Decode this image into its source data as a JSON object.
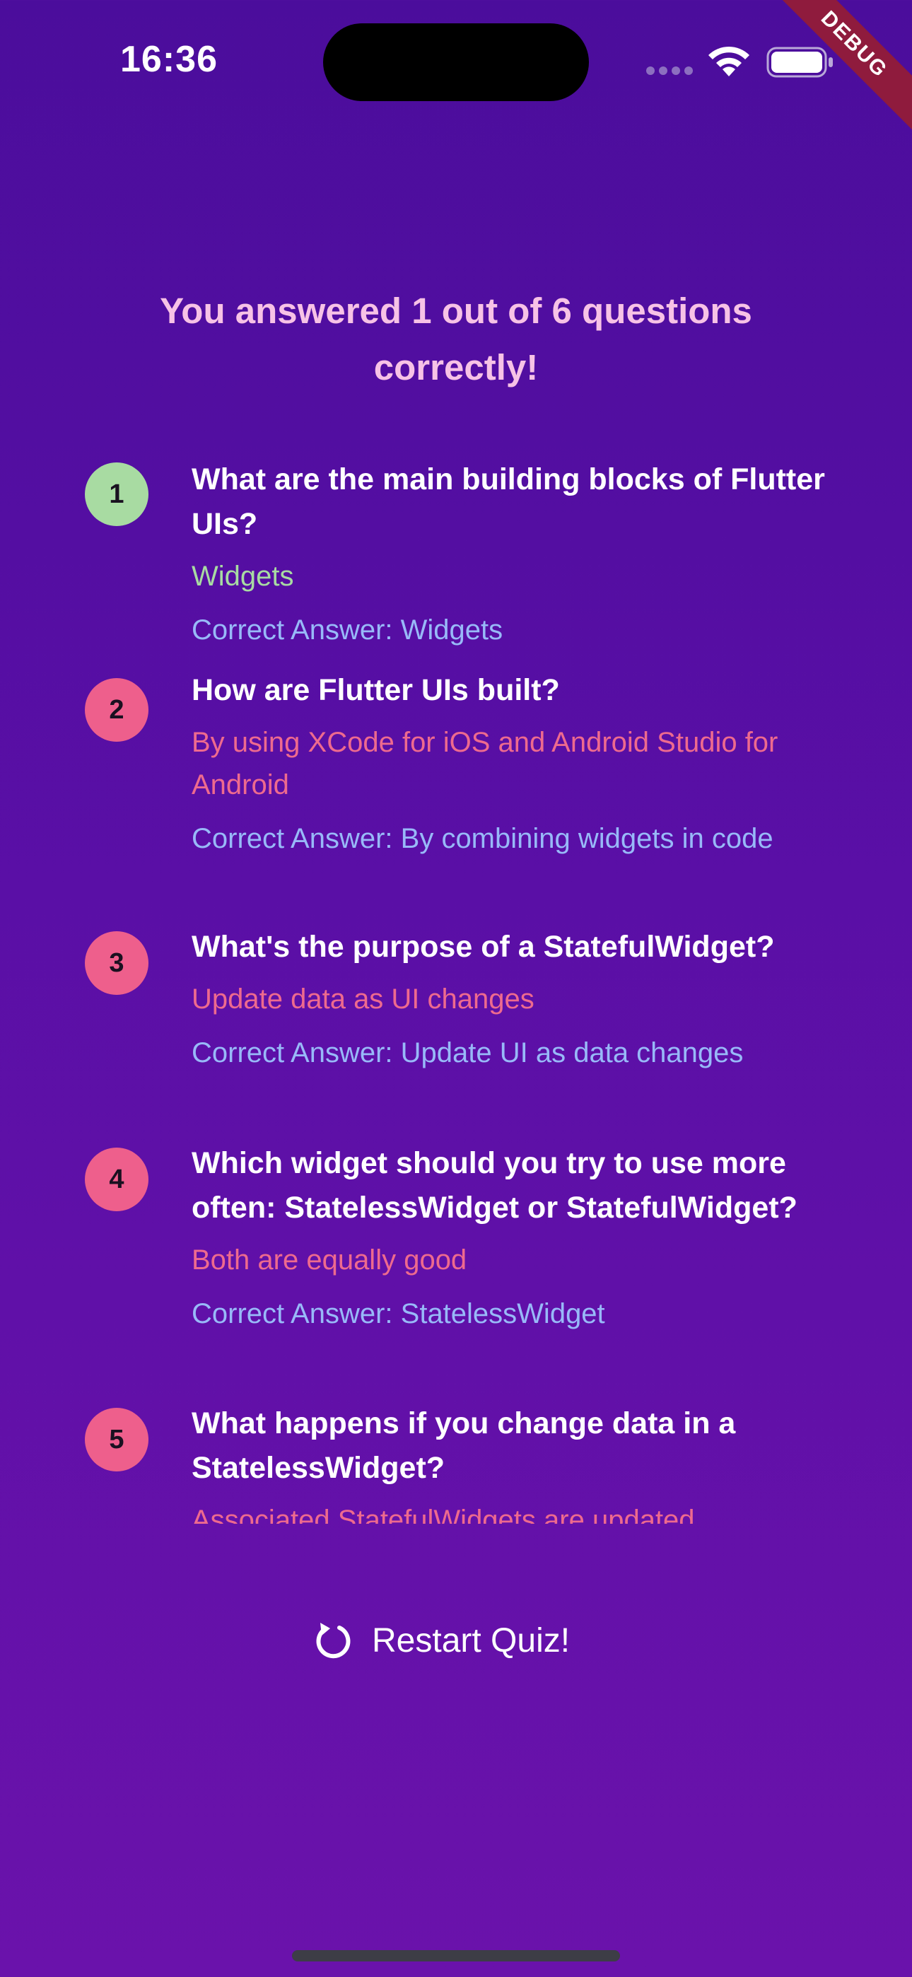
{
  "status_bar": {
    "time": "16:36",
    "debug_label": "DEBUG",
    "icons": [
      "cellular-signal-icon",
      "wifi-icon",
      "battery-icon"
    ]
  },
  "summary": {
    "title": "You answered 1 out of 6 questions correctly!"
  },
  "colors": {
    "background_top": "#4b0d9c",
    "background_bottom": "#6a12ab",
    "title": "#f7c2e6",
    "correct": "#a8dba2",
    "incorrect": "#ee5f8c",
    "correct_answer_text": "#98b9f8",
    "debug_ribbon": "#8f1b3d"
  },
  "questions": [
    {
      "index": "1",
      "is_correct": true,
      "question": "What are the main building blocks of Flutter UIs?",
      "user_answer": "Widgets",
      "correct_answer": "Correct Answer: Widgets"
    },
    {
      "index": "2",
      "is_correct": false,
      "question": "How are Flutter UIs built?",
      "user_answer": "By using XCode for iOS and Android Studio for Android",
      "correct_answer": "Correct Answer: By combining widgets in code"
    },
    {
      "index": "3",
      "is_correct": false,
      "question": "What's the purpose of a StatefulWidget?",
      "user_answer": "Update data as UI changes",
      "correct_answer": "Correct Answer: Update UI as data changes"
    },
    {
      "index": "4",
      "is_correct": false,
      "question": "Which widget should you try to use more often: StatelessWidget or StatefulWidget?",
      "user_answer": "Both are equally good",
      "correct_answer": "Correct Answer: StatelessWidget"
    },
    {
      "index": "5",
      "is_correct": false,
      "question": "What happens if you change data in a StatelessWidget?",
      "user_answer": "Associated StatefulWidgets are updated"
    }
  ],
  "restart_button": {
    "label": "Restart Quiz!",
    "icon": "restart-icon"
  }
}
